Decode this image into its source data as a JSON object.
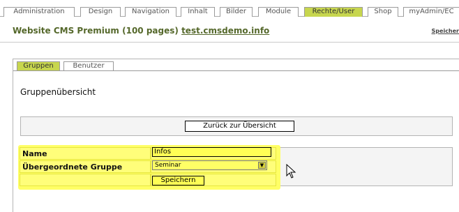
{
  "menu": {
    "tabs": [
      {
        "label": "Administration",
        "active": false
      },
      {
        "label": "Design",
        "active": false
      },
      {
        "label": "Navigation",
        "active": false
      },
      {
        "label": "Inhalt",
        "active": false
      },
      {
        "label": "Bilder",
        "active": false
      },
      {
        "label": "Module",
        "active": false
      },
      {
        "label": "Rechte/User",
        "active": true
      },
      {
        "label": "Shop",
        "active": false
      },
      {
        "label": "myAdmin/EC",
        "active": false
      }
    ]
  },
  "header": {
    "title_prefix": "Website CMS Premium (100 pages)",
    "domain": "test.cmsdemo.info",
    "save_link": "Speicher"
  },
  "subtabs": [
    {
      "label": "Gruppen",
      "active": true
    },
    {
      "label": "Benutzer",
      "active": false
    }
  ],
  "page": {
    "title": "Gruppenübersicht",
    "back_button": "Zurück zur Übersicht"
  },
  "form": {
    "name_label": "Name",
    "name_value": "Infos",
    "parent_label": "Übergeordnete Gruppe",
    "parent_value": "Seminar",
    "save_button": "Speichern"
  },
  "colors": {
    "accent_green": "#c7d64e",
    "title_green": "#55682b",
    "highlight_yellow": "#ffff66"
  },
  "icons": {
    "cursor": "mouse-pointer-icon",
    "dropdown": "chevron-down-icon"
  }
}
